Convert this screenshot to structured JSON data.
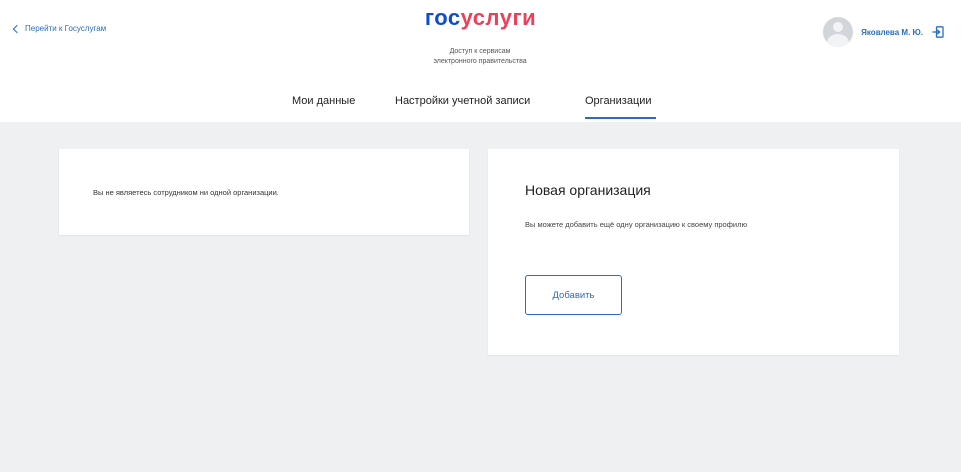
{
  "header": {
    "back_link": "Перейти к Госуслугам",
    "logo_part1": "гос",
    "logo_part2": "услуги",
    "tagline": "Доступ к сервисам\nэлектронного правительства",
    "user_name": "Яковлева М. Ю.",
    "avatar_icon": "user-avatar-icon",
    "logout_icon": "logout-icon"
  },
  "tabs": [
    {
      "label": "Мои данные",
      "active": false
    },
    {
      "label": "Настройки учетной записи",
      "active": false
    },
    {
      "label": "Организации",
      "active": true
    }
  ],
  "main": {
    "no_org_message": "Вы не являетесь сотрудником ни одной организации.",
    "new_org": {
      "title": "Новая организация",
      "description": "Вы можете добавить ещё одну организацию к своему профилю",
      "button_label": "Добавить"
    }
  },
  "colors": {
    "accent": "#2a6ebb",
    "logo_blue": "#0d4cd3",
    "logo_red": "#ee3f58",
    "background": "#eef0f2"
  }
}
